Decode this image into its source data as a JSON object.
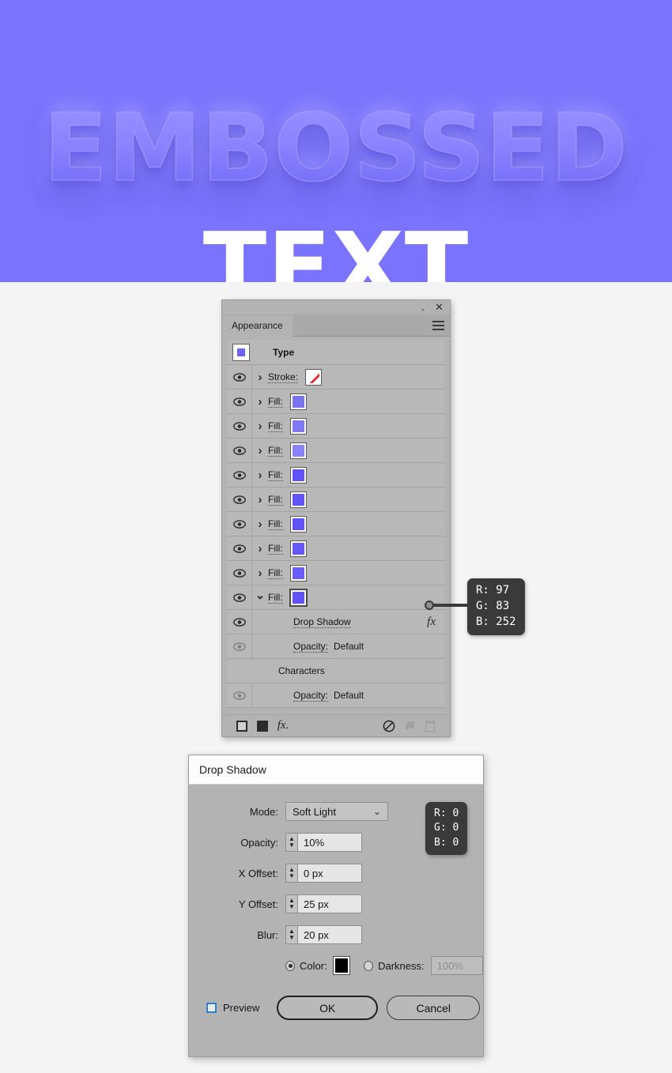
{
  "artwork": {
    "headline": "EMBOSSED",
    "subline": "TEXT",
    "background_color": "#7a73fd",
    "text_color": "#ffffff"
  },
  "panel": {
    "tab_label": "Appearance",
    "collapse_icon": "double-chevron-left",
    "close_icon": "close-x",
    "menu_icon": "hamburger-menu",
    "header_label": "Type",
    "rows": [
      {
        "kind": "stroke",
        "label": "Stroke:",
        "swatch": "none",
        "swatch_color": "#ffffff",
        "eye": "visible",
        "arrow": "collapsed"
      },
      {
        "kind": "fill",
        "label": "Fill:",
        "swatch_color": "#7b72f0",
        "eye": "visible",
        "arrow": "collapsed"
      },
      {
        "kind": "fill",
        "label": "Fill:",
        "swatch_color": "#8279f6",
        "eye": "visible",
        "arrow": "collapsed"
      },
      {
        "kind": "fill",
        "label": "Fill:",
        "swatch_color": "#8b82f8",
        "eye": "visible",
        "arrow": "collapsed"
      },
      {
        "kind": "fill",
        "label": "Fill:",
        "swatch_color": "#6153fc",
        "eye": "visible",
        "arrow": "collapsed"
      },
      {
        "kind": "fill",
        "label": "Fill:",
        "swatch_color": "#6154fb",
        "eye": "visible",
        "arrow": "collapsed"
      },
      {
        "kind": "fill",
        "label": "Fill:",
        "swatch_color": "#6053fc",
        "eye": "visible",
        "arrow": "collapsed"
      },
      {
        "kind": "fill",
        "label": "Fill:",
        "swatch_color": "#6457fb",
        "eye": "visible",
        "arrow": "collapsed"
      },
      {
        "kind": "fill",
        "label": "Fill:",
        "swatch_color": "#6a5dfa",
        "eye": "visible",
        "arrow": "collapsed"
      },
      {
        "kind": "fill",
        "label": "Fill:",
        "swatch_color": "#6153fc",
        "eye": "visible",
        "arrow": "expanded",
        "selected": true
      },
      {
        "kind": "effect",
        "label": "Drop Shadow",
        "eye": "visible",
        "fx": "fx"
      },
      {
        "kind": "opacity",
        "label": "Opacity:",
        "value": "Default",
        "eye": "dim"
      },
      {
        "kind": "section",
        "label": "Characters"
      },
      {
        "kind": "opacity",
        "label": "Opacity:",
        "value": "Default",
        "eye": "dim"
      }
    ],
    "footer_icons": [
      "add-new-stroke-icon",
      "add-new-fill-icon",
      "add-new-effect-icon",
      "clear-appearance-icon",
      "duplicate-item-icon",
      "delete-item-icon"
    ]
  },
  "tooltips": {
    "fill_color": {
      "r": "R: 97",
      "g": "G: 83",
      "b": "B: 252"
    },
    "shadow_color": {
      "r": "R: 0",
      "g": "G: 0",
      "b": "B: 0"
    }
  },
  "dialog": {
    "title": "Drop Shadow",
    "fields": {
      "mode_label": "Mode:",
      "mode_value": "Soft Light",
      "opacity_label": "Opacity:",
      "opacity_value": "10%",
      "xoffset_label": "X Offset:",
      "xoffset_value": "0 px",
      "yoffset_label": "Y Offset:",
      "yoffset_value": "25 px",
      "blur_label": "Blur:",
      "blur_value": "20 px",
      "color_label": "Color:",
      "color_value": "#000000",
      "darkness_label": "Darkness:",
      "darkness_value": "100%"
    },
    "preview_label": "Preview",
    "ok_label": "OK",
    "cancel_label": "Cancel"
  }
}
